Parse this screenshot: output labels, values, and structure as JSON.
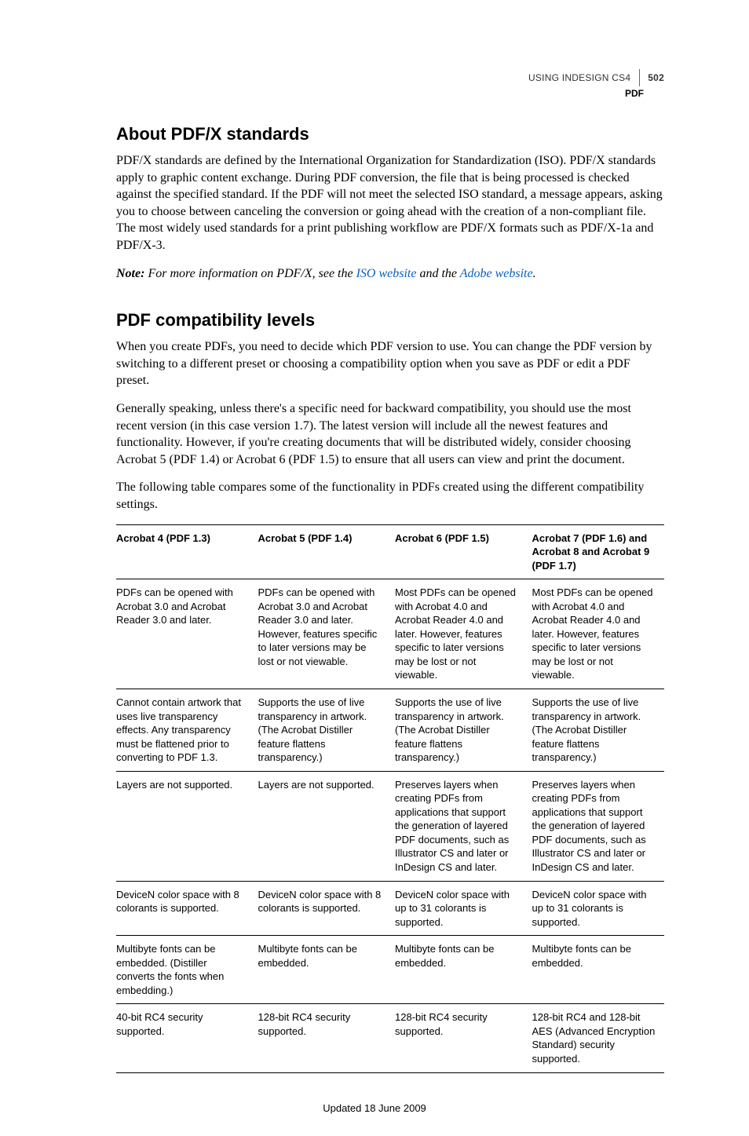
{
  "header": {
    "doc_title": "USING INDESIGN CS4",
    "page_number": "502",
    "section": "PDF"
  },
  "section1": {
    "heading": "About PDF/X standards",
    "p1": "PDF/X standards are defined by the International Organization for Standardization (ISO). PDF/X standards apply to graphic content exchange. During PDF conversion, the file that is being processed is checked against the specified standard. If the PDF will not meet the selected ISO standard, a message appears, asking you to choose between canceling the conversion or going ahead with the creation of a non-compliant file. The most widely used standards for a print publishing workflow are PDF/X formats such as PDF/X-1a and PDF/X-3.",
    "note_label": "Note:",
    "note_pre": " For more information on PDF/X, see the ",
    "iso_link": "ISO website",
    "note_mid": " and the ",
    "adobe_link": "Adobe website",
    "note_end": "."
  },
  "section2": {
    "heading": "PDF compatibility levels",
    "p1": "When you create PDFs, you need to decide which PDF version to use. You can change the PDF version by switching to a different preset or choosing a compatibility option when you save as PDF or edit a PDF preset.",
    "p2": "Generally speaking, unless there's a specific need for backward compatibility, you should use the most recent version (in this case version 1.7). The latest version will include all the newest features and functionality. However, if you're creating documents that will be distributed widely, consider choosing Acrobat 5 (PDF 1.4) or Acrobat 6 (PDF 1.5) to ensure that all users can view and print the document.",
    "p3": "The following table compares some of the functionality in PDFs created using the different compatibility settings."
  },
  "table": {
    "headers": [
      "Acrobat 4 (PDF 1.3)",
      "Acrobat 5 (PDF 1.4)",
      "Acrobat 6 (PDF 1.5)",
      "Acrobat 7 (PDF 1.6) and Acrobat 8 and Acrobat 9 (PDF 1.7)"
    ],
    "rows": [
      [
        "PDFs can be opened with Acrobat 3.0 and Acrobat Reader 3.0 and later.",
        "PDFs can be opened with Acrobat 3.0 and Acrobat Reader 3.0 and later. However, features specific to later versions may be lost or not viewable.",
        "Most PDFs can be opened with Acrobat 4.0 and Acrobat Reader 4.0 and later. However, features specific to later versions may be lost or not viewable.",
        "Most PDFs can be opened with Acrobat 4.0 and Acrobat Reader 4.0 and later. However, features specific to later versions may be lost or not viewable."
      ],
      [
        "Cannot contain artwork that uses live transparency effects. Any transparency must be flattened prior to converting to PDF 1.3.",
        "Supports the use of live transparency in artwork. (The Acrobat Distiller feature flattens transparency.)",
        "Supports the use of live transparency in artwork. (The Acrobat Distiller feature flattens transparency.)",
        "Supports the use of live transparency in artwork. (The Acrobat Distiller feature flattens transparency.)"
      ],
      [
        "Layers are not supported.",
        "Layers are not supported.",
        "Preserves layers when creating PDFs from applications that support the generation of layered PDF documents, such as Illustrator CS and later or InDesign CS and later.",
        "Preserves layers when creating PDFs from applications that support the generation of layered PDF documents, such as Illustrator CS and later or InDesign CS and later."
      ],
      [
        "DeviceN color space with 8 colorants is supported.",
        "DeviceN color space with 8 colorants is supported.",
        "DeviceN color space with up to 31 colorants is supported.",
        "DeviceN color space with up to 31 colorants is supported."
      ],
      [
        "Multibyte fonts can be embedded. (Distiller converts the fonts when embedding.)",
        "Multibyte fonts can be embedded.",
        "Multibyte fonts can be embedded.",
        "Multibyte fonts can be embedded."
      ],
      [
        "40-bit RC4 security supported.",
        "128-bit RC4 security supported.",
        "128-bit RC4 security supported.",
        "128-bit RC4 and 128-bit AES (Advanced Encryption Standard) security supported."
      ]
    ]
  },
  "footer": {
    "updated": "Updated 18 June 2009"
  }
}
